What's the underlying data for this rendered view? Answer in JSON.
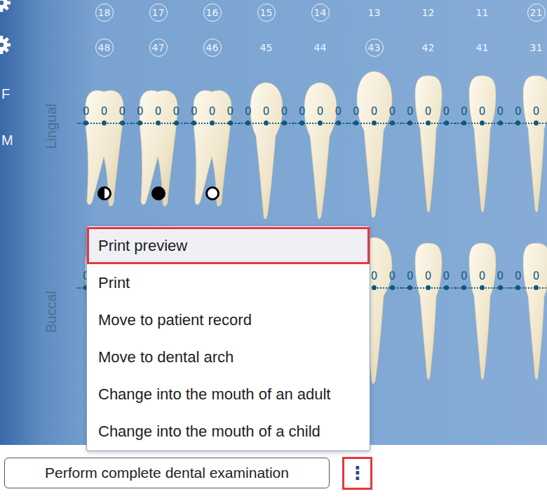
{
  "sidebar": {
    "letters": [
      "F",
      "M"
    ]
  },
  "sections": {
    "lingual": "Lingual",
    "buccal": "Buccal"
  },
  "teeth": [
    {
      "upper": "18",
      "upper_circled": true,
      "lower": "48",
      "lower_circled": true,
      "kind": "molar",
      "marker": "half",
      "lingual": [
        "0",
        "0",
        "0"
      ],
      "buccal": [
        "0",
        "",
        ""
      ]
    },
    {
      "upper": "17",
      "upper_circled": true,
      "lower": "47",
      "lower_circled": true,
      "kind": "molar",
      "marker": "full",
      "lingual": [
        "0",
        "0",
        "0"
      ],
      "buccal": [
        "",
        "",
        ""
      ]
    },
    {
      "upper": "16",
      "upper_circled": true,
      "lower": "46",
      "lower_circled": true,
      "kind": "molar",
      "marker": "empty",
      "lingual": [
        "0",
        "0",
        "0"
      ],
      "buccal": [
        "",
        "",
        ""
      ]
    },
    {
      "upper": "15",
      "upper_circled": true,
      "lower": "45",
      "lower_circled": false,
      "kind": "premolar",
      "marker": "none",
      "lingual": [
        "0",
        "0",
        "0"
      ],
      "buccal": [
        "",
        "",
        ""
      ]
    },
    {
      "upper": "14",
      "upper_circled": true,
      "lower": "44",
      "lower_circled": false,
      "kind": "premolar",
      "marker": "none",
      "lingual": [
        "0",
        "0",
        "0"
      ],
      "buccal": [
        "",
        "",
        ""
      ]
    },
    {
      "upper": "13",
      "upper_circled": false,
      "lower": "43",
      "lower_circled": true,
      "kind": "canine",
      "marker": "none",
      "lingual": [
        "0",
        "0",
        "0"
      ],
      "buccal": [
        "",
        "0",
        "0"
      ]
    },
    {
      "upper": "12",
      "upper_circled": false,
      "lower": "42",
      "lower_circled": false,
      "kind": "incisor",
      "marker": "none",
      "lingual": [
        "0",
        "0",
        "0"
      ],
      "buccal": [
        "0",
        "0",
        "0"
      ]
    },
    {
      "upper": "11",
      "upper_circled": false,
      "lower": "41",
      "lower_circled": false,
      "kind": "incisor",
      "marker": "none",
      "lingual": [
        "0",
        "0",
        "0"
      ],
      "buccal": [
        "0",
        "0",
        "0"
      ]
    },
    {
      "upper": "21",
      "upper_circled": true,
      "lower": "31",
      "lower_circled": false,
      "kind": "incisor",
      "marker": "none",
      "lingual": [
        "0",
        "0",
        ""
      ],
      "buccal": [
        "0",
        "0",
        ""
      ]
    }
  ],
  "menu": {
    "items": [
      {
        "label": "Print preview",
        "highlighted": true
      },
      {
        "label": "Print",
        "highlighted": false
      },
      {
        "label": "Move to patient record",
        "highlighted": false
      },
      {
        "label": "Move to dental arch",
        "highlighted": false
      },
      {
        "label": "Change into the mouth of an adult",
        "highlighted": false
      },
      {
        "label": "Change into the mouth of a child",
        "highlighted": false
      }
    ]
  },
  "footer": {
    "button": "Perform complete dental examination",
    "more": {
      "label": "⋮",
      "highlighted": true
    }
  }
}
